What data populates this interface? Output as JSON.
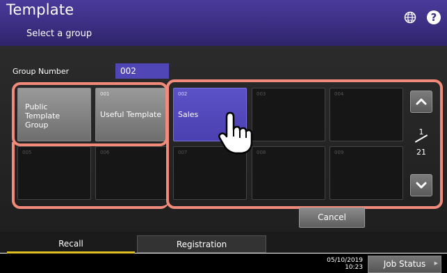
{
  "header": {
    "title": "Template",
    "subtitle": "Select a group"
  },
  "group_number": {
    "label": "Group Number",
    "value": "002"
  },
  "groups": [
    {
      "num": "",
      "label": "Public Template Group"
    },
    {
      "num": "001",
      "label": "Useful Template"
    },
    {
      "num": "002",
      "label": "Sales",
      "selected": true
    },
    {
      "num": "003",
      "label": ""
    },
    {
      "num": "004",
      "label": ""
    },
    {
      "num": "005",
      "label": ""
    },
    {
      "num": "006",
      "label": ""
    },
    {
      "num": "007",
      "label": ""
    },
    {
      "num": "008",
      "label": ""
    },
    {
      "num": "009",
      "label": ""
    }
  ],
  "pagination": {
    "current": "1",
    "total": "21"
  },
  "buttons": {
    "cancel": "Cancel",
    "job_status": "Job Status"
  },
  "tabs": [
    {
      "label": "Recall",
      "active": true
    },
    {
      "label": "Registration"
    }
  ],
  "footer": {
    "date": "05/10/2019",
    "time": "10:23"
  },
  "colors": {
    "title_bar": "#3a2d80",
    "selected_cell": "#5046b5",
    "highlight": "#f08a7a",
    "active_tab": "#e0c020"
  }
}
